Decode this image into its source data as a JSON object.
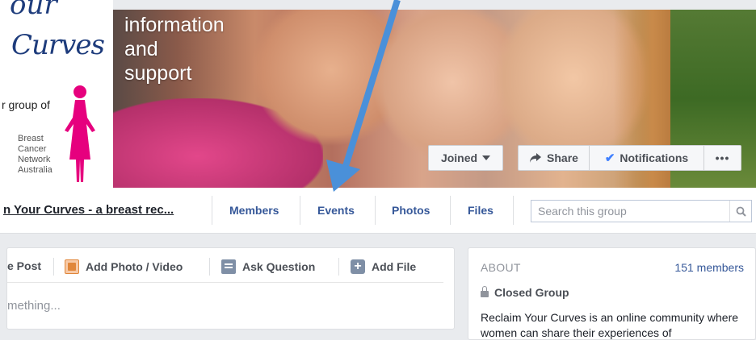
{
  "logo": {
    "top_text": "our",
    "curves_text": "Curves",
    "group_line": "r group of",
    "bcna_lines": [
      "Breast",
      "Cancer",
      "Network",
      "Australia"
    ]
  },
  "cover": {
    "text_lines": [
      "information",
      "and",
      "support"
    ]
  },
  "actions": {
    "joined_label": "Joined",
    "share_label": "Share",
    "notifications_label": "Notifications",
    "more_label": "•••"
  },
  "nav": {
    "group_name": "n Your Curves - a breast rec...",
    "items": [
      "Members",
      "Events",
      "Photos",
      "Files"
    ],
    "search_placeholder": "Search this group"
  },
  "composer": {
    "post_label": "e Post",
    "add_photo_label": "Add Photo / Video",
    "ask_label": "Ask Question",
    "add_file_label": "Add File",
    "placeholder": "mething..."
  },
  "about": {
    "title": "ABOUT",
    "members": "151 members",
    "privacy": "Closed Group",
    "description": "Reclaim Your Curves is an online community where women can share their experiences of"
  },
  "colors": {
    "link": "#365899",
    "brand_pink": "#e6007e",
    "annotation_arrow": "#4a90d9"
  }
}
